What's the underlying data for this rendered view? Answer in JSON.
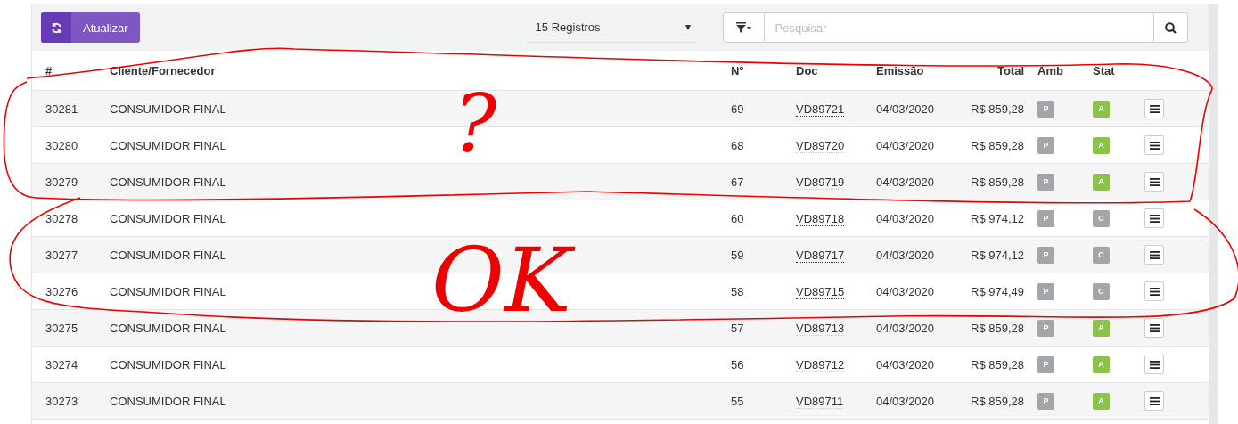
{
  "toolbar": {
    "refresh_button": "Atualizar",
    "page_size": "15 Registros",
    "search": {
      "placeholder": "Pesquisar"
    }
  },
  "table": {
    "columns": [
      "#",
      "Cliente/Fornecedor",
      "Nº",
      "Doc",
      "Emissão",
      "Total",
      "Amb",
      "Stat"
    ],
    "rows": [
      {
        "id": "30281",
        "client": "CONSUMIDOR FINAL",
        "number": "69",
        "doc": "VD89721",
        "doc_visited": true,
        "date": "04/03/2020",
        "total": "R$ 859,28",
        "amb": "P",
        "stat": "A",
        "color": "#8bc34a"
      },
      {
        "id": "30280",
        "client": "CONSUMIDOR FINAL",
        "number": "68",
        "doc": "VD89720",
        "doc_visited": false,
        "date": "04/03/2020",
        "total": "R$ 859,28",
        "amb": "P",
        "stat": "A",
        "color": "#8bc34a"
      },
      {
        "id": "30279",
        "client": "CONSUMIDOR FINAL",
        "number": "67",
        "doc": "VD89719",
        "doc_visited": false,
        "date": "04/03/2020",
        "total": "R$ 859,28",
        "amb": "P",
        "stat": "A",
        "color": "#8bc34a"
      },
      {
        "id": "30278",
        "client": "CONSUMIDOR FINAL",
        "number": "60",
        "doc": "VD89718",
        "doc_visited": true,
        "date": "04/03/2020",
        "total": "R$ 974,12",
        "amb": "P",
        "stat": "C",
        "color": "#a3a6a9"
      },
      {
        "id": "30277",
        "client": "CONSUMIDOR FINAL",
        "number": "59",
        "doc": "VD89717",
        "doc_visited": true,
        "date": "04/03/2020",
        "total": "R$ 974,12",
        "amb": "P",
        "stat": "C",
        "color": "#a3a6a9"
      },
      {
        "id": "30276",
        "client": "CONSUMIDOR FINAL",
        "number": "58",
        "doc": "VD89715",
        "doc_visited": true,
        "date": "04/03/2020",
        "total": "R$ 974,49",
        "amb": "P",
        "stat": "C",
        "color": "#a3a6a9"
      },
      {
        "id": "30275",
        "client": "CONSUMIDOR FINAL",
        "number": "57",
        "doc": "VD89713",
        "doc_visited": false,
        "date": "04/03/2020",
        "total": "R$ 859,28",
        "amb": "P",
        "stat": "A",
        "color": "#8bc34a"
      },
      {
        "id": "30274",
        "client": "CONSUMIDOR FINAL",
        "number": "56",
        "doc": "VD89712",
        "doc_visited": false,
        "date": "04/03/2020",
        "total": "R$ 859,28",
        "amb": "P",
        "stat": "A",
        "color": "#8bc34a"
      },
      {
        "id": "30273",
        "client": "CONSUMIDOR FINAL",
        "number": "55",
        "doc": "VD89711",
        "doc_visited": false,
        "date": "04/03/2020",
        "total": "R$ 859,28",
        "amb": "P",
        "stat": "A",
        "color": "#8bc34a"
      }
    ]
  },
  "annotations": [
    {
      "text": "?"
    },
    {
      "text": "OK"
    }
  ]
}
